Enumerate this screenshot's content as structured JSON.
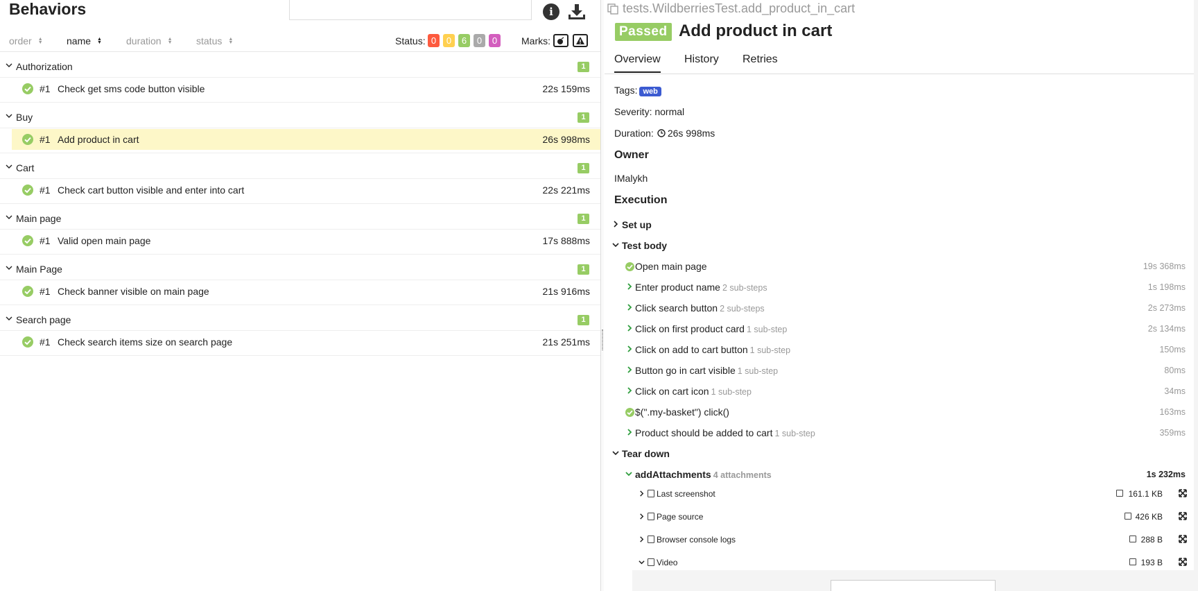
{
  "left": {
    "title": "Behaviors",
    "sort": [
      {
        "label": "order",
        "active": false
      },
      {
        "label": "name",
        "active": true
      },
      {
        "label": "duration",
        "active": false
      },
      {
        "label": "status",
        "active": false
      }
    ],
    "status_label": "Status:",
    "status_counts": [
      {
        "value": "0",
        "color": "#fd5a3e"
      },
      {
        "value": "0",
        "color": "#ffd050"
      },
      {
        "value": "6",
        "color": "#97cc64"
      },
      {
        "value": "0",
        "color": "#aaaaaa"
      },
      {
        "value": "0",
        "color": "#d35ebe"
      }
    ],
    "marks_label": "Marks:",
    "groups": [
      {
        "name": "Authorization",
        "count": "1",
        "item": {
          "num": "#1",
          "name": "Check get sms code button visible",
          "duration": "22s 159ms"
        }
      },
      {
        "name": "Buy",
        "count": "1",
        "item": {
          "num": "#1",
          "name": "Add product in cart",
          "duration": "26s 998ms"
        }
      },
      {
        "name": "Cart",
        "count": "1",
        "item": {
          "num": "#1",
          "name": "Check cart button visible and enter into cart",
          "duration": "22s 221ms"
        }
      },
      {
        "name": "Main page",
        "count": "1",
        "item": {
          "num": "#1",
          "name": "Valid open main page",
          "duration": "17s 888ms"
        }
      },
      {
        "name": "Main Page",
        "count": "1",
        "item": {
          "num": "#1",
          "name": "Check banner visible on main page",
          "duration": "21s 916ms"
        }
      },
      {
        "name": "Search page",
        "count": "1",
        "item": {
          "num": "#1",
          "name": "Check search items size on search page",
          "duration": "21s 251ms"
        }
      }
    ]
  },
  "right": {
    "full_name": "tests.WildberriesTest.add_product_in_cart",
    "status": "Passed",
    "title": "Add product in cart",
    "tabs": [
      "Overview",
      "History",
      "Retries"
    ],
    "tags_label": "Tags:",
    "tag": "web",
    "severity_label": "Severity: normal",
    "duration_label": "Duration:",
    "duration": "26s 998ms",
    "owner_heading": "Owner",
    "owner": "IMalykh",
    "execution_heading": "Execution",
    "setup": "Set up",
    "test_body": "Test body",
    "steps": [
      {
        "name": "Open main page",
        "sub": "",
        "dur": "19s 368ms",
        "kind": "ok"
      },
      {
        "name": "Enter product name",
        "sub": "2 sub-steps",
        "dur": "1s 198ms",
        "kind": "exp"
      },
      {
        "name": "Click search button",
        "sub": "2 sub-steps",
        "dur": "2s 273ms",
        "kind": "exp"
      },
      {
        "name": "Click on first product card",
        "sub": "1 sub-step",
        "dur": "2s 134ms",
        "kind": "exp"
      },
      {
        "name": "Click on add to cart button",
        "sub": "1 sub-step",
        "dur": "150ms",
        "kind": "exp"
      },
      {
        "name": "Button go in cart visible",
        "sub": "1 sub-step",
        "dur": "80ms",
        "kind": "exp"
      },
      {
        "name": "Click on cart icon",
        "sub": "1 sub-step",
        "dur": "34ms",
        "kind": "exp"
      },
      {
        "name": "$(\".my-basket\") click()",
        "sub": "",
        "dur": "163ms",
        "kind": "ok"
      },
      {
        "name": "Product should be added to cart",
        "sub": "1 sub-step",
        "dur": "359ms",
        "kind": "exp"
      }
    ],
    "teardown": "Tear down",
    "add_attachments": {
      "name": "addAttachments",
      "sub": "4 attachments",
      "dur": "1s 232ms"
    },
    "attachments": [
      {
        "name": "Last screenshot",
        "size": "161.1 KB",
        "icon": "image-icon",
        "open": false
      },
      {
        "name": "Page source",
        "size": "426 KB",
        "icon": "code-file-icon",
        "open": false
      },
      {
        "name": "Browser console logs",
        "size": "288 B",
        "icon": "text-file-icon",
        "open": false
      },
      {
        "name": "Video",
        "size": "193 B",
        "icon": "code-file-icon",
        "open": true
      }
    ]
  }
}
